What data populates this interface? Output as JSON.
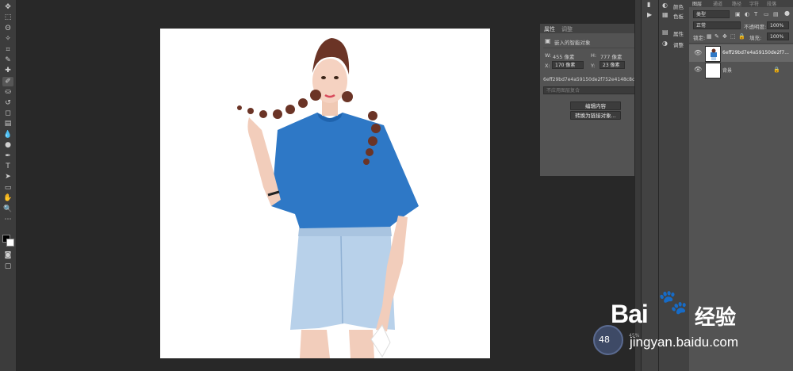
{
  "toolbar": {
    "icons": [
      "move-icon",
      "marquee-icon",
      "lasso-icon",
      "magic-wand-icon",
      "crop-icon",
      "eyedropper-icon",
      "healing-brush-icon",
      "brush-icon",
      "clone-stamp-icon",
      "history-brush-icon",
      "eraser-icon",
      "gradient-icon",
      "blur-icon",
      "dodge-icon",
      "pen-icon",
      "type-icon",
      "path-selection-icon",
      "shape-icon",
      "hand-icon",
      "zoom-icon",
      "more-tools-icon"
    ],
    "glyphs": [
      "✥",
      "⬚",
      "ʘ",
      "✧",
      "⌗",
      "✎",
      "✚",
      "✐",
      "⛀",
      "↺",
      "◻",
      "▤",
      "💧",
      "●",
      "✒",
      "T",
      "➤",
      "▭",
      "✋",
      "🔍",
      "⋯"
    ]
  },
  "properties": {
    "tab_properties": "属性",
    "tab_adjustments": "调整",
    "title": "嵌入的智能对象",
    "w_label": "W:",
    "w_value": "455 像素",
    "h_label": "H:",
    "h_value": "777 像素",
    "x_label": "X:",
    "x_value": "170 像素",
    "y_label": "Y:",
    "y_value": "23 像素",
    "filename": "6eff29bd7e4a59150de2f752e4148c8c77c5d8d8...",
    "layer_comp_placeholder": "不应用图层复合",
    "edit_contents": "编辑内容",
    "convert_linked": "转换为链接对象..."
  },
  "dock": {
    "color": "颜色",
    "swatches": "色板",
    "properties": "属性",
    "adjustments": "调整"
  },
  "layers": {
    "tabs": [
      "图层",
      "通道",
      "路径",
      "字符",
      "段落"
    ],
    "filter_kind": "类型",
    "blend_mode": "正常",
    "opacity_label": "不透明度:",
    "opacity_value": "100%",
    "lock_label": "锁定:",
    "fill_label": "填充:",
    "fill_value": "100%",
    "items": [
      {
        "name": "6eff29bd7e4a59150de2f7..."
      },
      {
        "name": "背景"
      }
    ]
  },
  "status": {
    "zoom_value": "48",
    "percent": "45%"
  },
  "watermark": {
    "brand": "Bai",
    "brand2": "经验",
    "url": "jingyan.baidu.com"
  }
}
